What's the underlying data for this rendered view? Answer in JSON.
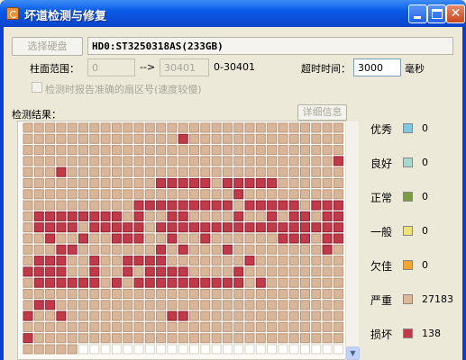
{
  "window": {
    "title": "坏道检测与修复",
    "close_glyph": "✕"
  },
  "disk": {
    "select_label": "选择硬盘",
    "selected": "HD0:ST3250318AS(233GB)"
  },
  "cylinder": {
    "label": "柱面范围：",
    "from": "0",
    "arrow": "-->",
    "to": "30401",
    "range_text": "0-30401"
  },
  "timeout": {
    "label": "超时时间：",
    "value": "3000",
    "unit": "毫秒"
  },
  "report_option": {
    "label": "检测时报告准确的扇区号(速度较慢)",
    "checked": false
  },
  "results": {
    "label": "检测结果：",
    "detail_button": "详细信息",
    "scroll_down_glyph": "▼"
  },
  "legend": [
    {
      "name": "优秀",
      "color": "#7fc8e0",
      "count": "0"
    },
    {
      "name": "良好",
      "color": "#a7d8cf",
      "count": "0"
    },
    {
      "name": "正常",
      "color": "#7b9b45",
      "count": "0"
    },
    {
      "name": "一般",
      "color": "#f0e27a",
      "count": "0"
    },
    {
      "name": "欠佳",
      "color": "#f2a531",
      "count": "0"
    },
    {
      "name": "严重",
      "color": "#dcb79a",
      "count": "27183"
    },
    {
      "name": "损坏",
      "color": "#c0394a",
      "count": "138"
    }
  ],
  "grid_colors": {
    "severe": "#d9b59a",
    "damaged": "#c13a4a",
    "unscanned": "#ffffff"
  }
}
